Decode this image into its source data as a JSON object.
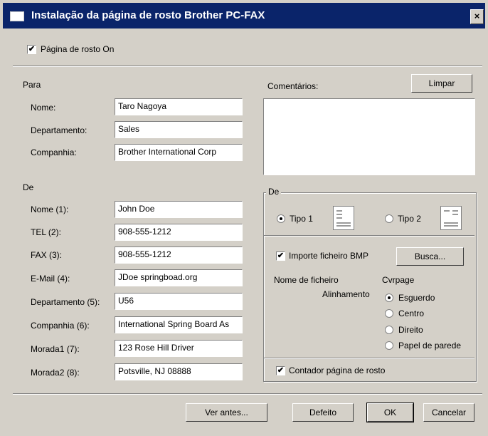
{
  "window": {
    "title": "Instalação da página de rosto Brother PC-FAX",
    "close": "×"
  },
  "cover_on": {
    "label": "Página de rosto On",
    "checked": true
  },
  "para": {
    "heading": "Para",
    "fields": [
      {
        "label": "Nome:",
        "value": "Taro Nagoya"
      },
      {
        "label": "Departamento:",
        "value": "Sales"
      },
      {
        "label": "Companhia:",
        "value": "Brother International Corp"
      }
    ]
  },
  "de": {
    "heading": "De",
    "fields": [
      {
        "label": "Nome (1):",
        "value": "John Doe"
      },
      {
        "label": "TEL (2):",
        "value": "908-555-1212"
      },
      {
        "label": "FAX (3):",
        "value": "908-555-1212"
      },
      {
        "label": "E-Mail (4):",
        "value": "JDoe springboad.org"
      },
      {
        "label": "Departamento (5):",
        "value": "U56"
      },
      {
        "label": "Companhia (6):",
        "value": "International  Spring Board As"
      },
      {
        "label": "Morada1 (7):",
        "value": "123 Rose Hill Driver"
      },
      {
        "label": "Morada2 (8):",
        "value": "Potsville, NJ 08888"
      }
    ]
  },
  "comments": {
    "label": "Comentários:",
    "clear_button": "Limpar",
    "value": ""
  },
  "template": {
    "group_label": "De",
    "tipo1": {
      "label": "Tipo 1",
      "selected": true
    },
    "tipo2": {
      "label": "Tipo 2",
      "selected": false
    },
    "import_bmp": {
      "label": "Importe ficheiro BMP",
      "checked": true
    },
    "browse_button": "Busca...",
    "filename_label": "Nome de ficheiro",
    "filename_value": "Cvrpage",
    "alignment_label": "Alinhamento",
    "alignment_options": [
      {
        "label": "Esguerdo",
        "selected": true
      },
      {
        "label": "Centro",
        "selected": false
      },
      {
        "label": "Direito",
        "selected": false
      },
      {
        "label": "Papel de parede",
        "selected": false
      }
    ],
    "counter": {
      "label": "Contador página de rosto",
      "checked": true
    }
  },
  "buttons": {
    "preview": "Ver antes...",
    "default": "Defeito",
    "ok": "OK",
    "cancel": "Cancelar"
  },
  "colors": {
    "titlebar": "#0a246a",
    "face": "#d4d0c8"
  }
}
